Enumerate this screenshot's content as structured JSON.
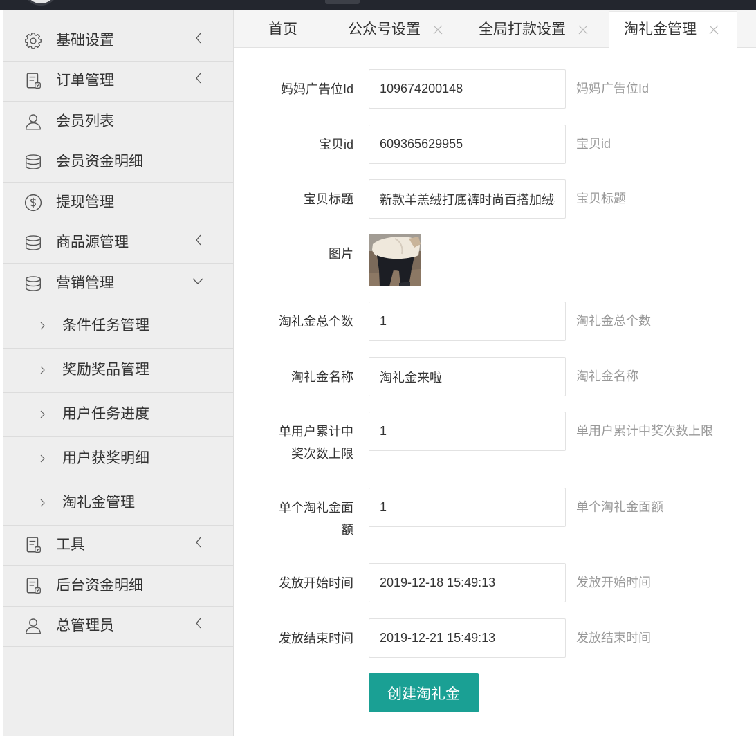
{
  "header": {
    "logo_icon": "logo-icon"
  },
  "colors": {
    "accent": "#1aa094",
    "topbar": "#23262e",
    "sidebar_bg": "#eeeeee",
    "hint_text": "#999999"
  },
  "sidebar": {
    "menu": [
      {
        "label": "基础设置",
        "icon": "gear-icon",
        "arrow_icon": "chevron-left-icon"
      },
      {
        "label": "订单管理",
        "icon": "receipt-icon",
        "arrow_icon": "chevron-left-icon"
      },
      {
        "label": "会员列表",
        "icon": "user-icon"
      },
      {
        "label": "会员资金明细",
        "icon": "database-icon"
      },
      {
        "label": "提现管理",
        "icon": "dollar-circle-icon"
      },
      {
        "label": "商品源管理",
        "icon": "database-icon",
        "arrow_icon": "chevron-left-icon"
      },
      {
        "label": "营销管理",
        "icon": "database-icon",
        "arrow_icon": "chevron-down-icon",
        "expanded": true,
        "children": [
          {
            "label": "条件任务管理"
          },
          {
            "label": "奖励奖品管理"
          },
          {
            "label": "用户任务进度"
          },
          {
            "label": "用户获奖明细"
          },
          {
            "label": "淘礼金管理"
          }
        ]
      },
      {
        "label": "工具",
        "icon": "receipt-icon",
        "arrow_icon": "chevron-left-icon"
      },
      {
        "label": "后台资金明细",
        "icon": "receipt-icon"
      },
      {
        "label": "总管理员",
        "icon": "user-icon",
        "arrow_icon": "chevron-left-icon"
      }
    ]
  },
  "tabs": [
    {
      "label": "首页",
      "closable": false,
      "active": false
    },
    {
      "label": "公众号设置",
      "closable": true,
      "active": false
    },
    {
      "label": "全局打款设置",
      "closable": true,
      "active": false
    },
    {
      "label": "淘礼金管理",
      "closable": true,
      "active": true
    }
  ],
  "form": {
    "fields": [
      {
        "label": "妈妈广告位Id",
        "value": "109674200148",
        "hint": "妈妈广告位Id"
      },
      {
        "label": "宝贝id",
        "value": "609365629955",
        "hint": "宝贝id"
      },
      {
        "label": "宝贝标题",
        "value": "新款羊羔绒打底裤时尚百搭加绒小",
        "hint": "宝贝标题"
      },
      {
        "label": "淘礼金总个数",
        "value": "1",
        "hint": "淘礼金总个数"
      },
      {
        "label": "淘礼金名称",
        "value": "淘礼金来啦",
        "hint": "淘礼金名称"
      },
      {
        "label": "单用户累计中奖次数上限",
        "value": "1",
        "hint": "单用户累计中奖次数上限"
      },
      {
        "label": "单个淘礼金面额",
        "value": "1",
        "hint": "单个淘礼金面额"
      },
      {
        "label": "发放开始时间",
        "value": "2019-12-18 15:49:13",
        "hint": "发放开始时间"
      },
      {
        "label": "发放结束时间",
        "value": "2019-12-21 15:49:13",
        "hint": "发放结束时间"
      }
    ],
    "image_field": {
      "label": "图片"
    },
    "submit_label": "创建淘礼金"
  }
}
